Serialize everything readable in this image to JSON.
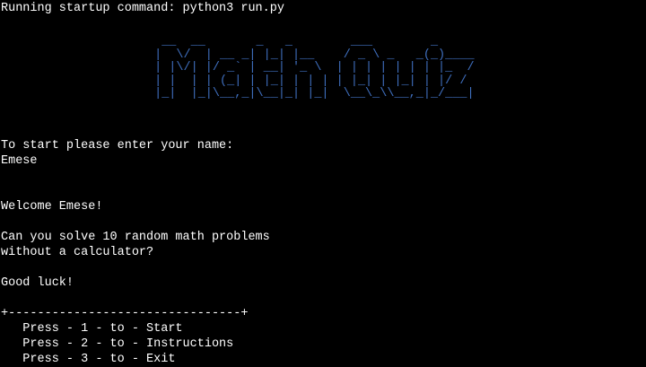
{
  "colors": {
    "background": "#000000",
    "text": "#ffffff",
    "banner": "#3f6fbf"
  },
  "terminal": {
    "startup_line": "Running startup command: python3 run.py",
    "banner_art": "  __  __       _   _        ___        _     \n |  \\/  | __ _| |_| |__    / _ \\ _   _(_)____\n | |\\/| |/ _` | __| '_ \\  | | | | | | | |_  /\n | |  | | (_| | |_| | | | | |_| | |_| | |/ / \n |_|  |_|\\__,_|\\__|_| |_|  \\__\\_\\\\__,_|_/___|",
    "prompt": "To start please enter your name:",
    "user_input": "Emese",
    "welcome": "Welcome Emese!",
    "question_line1": "Can you solve 10 random math problems",
    "question_line2": "without a calculator?",
    "good_luck": "Good luck!",
    "menu_border": "+--------------------------------+",
    "menu": [
      {
        "label": "   Press - 1 - to - Start"
      },
      {
        "label": "   Press - 2 - to - Instructions"
      },
      {
        "label": "   Press - 3 - to - Exit"
      }
    ]
  }
}
